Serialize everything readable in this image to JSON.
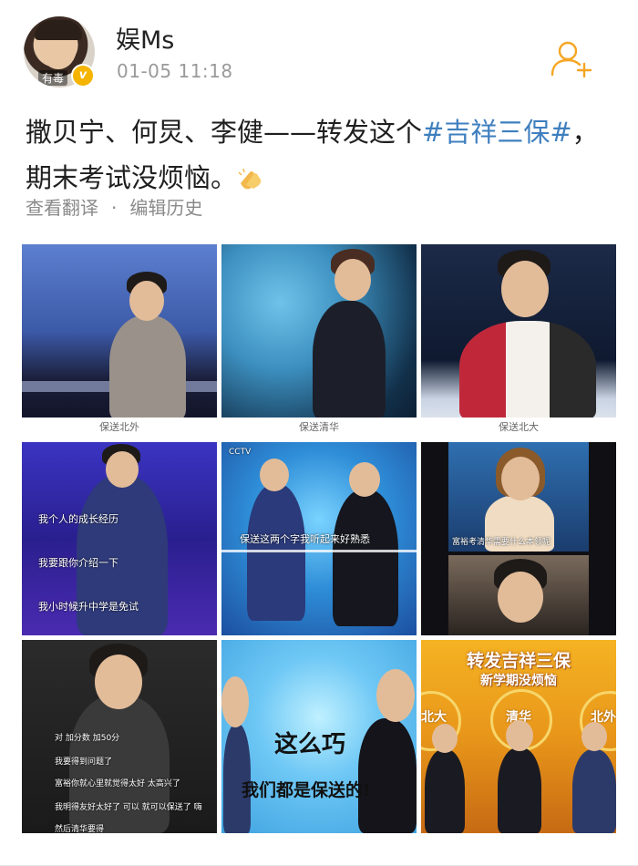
{
  "post": {
    "username": "娱Ms",
    "timestamp": "01-05 11:18",
    "avatar_tag": "有毒",
    "verified_badge": "v",
    "text_before": "撒贝宁、何炅、李健——转发这个",
    "hashtag": "#吉祥三保#",
    "text_after": "，期末考试没烦恼。",
    "see_translation": "查看翻译",
    "separator": "·",
    "edit_history": "编辑历史"
  },
  "photos": {
    "p1": {
      "caption": "保送北外"
    },
    "p2": {
      "caption": "保送清华"
    },
    "p3": {
      "caption": "保送北大"
    },
    "p4": {
      "sub1": "我个人的成长经历",
      "sub2": "我要跟你介绍一下",
      "sub3": "我小时候升中学是免试"
    },
    "p5": {
      "sub1": "保送这两个字我听起来好熟悉",
      "logo": "CCTV"
    },
    "p6": {
      "sub1": "富裕考清华需要什么本领呢"
    },
    "p7": {
      "sub1": "对 加分数 加50分",
      "sub2": "我要得到问题了",
      "sub3": "富裕你就心里就觉得太好 太高兴了",
      "sub4": "我明得友好太好了 可以 就可以保送了 嗨",
      "sub5": "然后清华要得"
    },
    "p8": {
      "line1": "这么巧",
      "line2": "我们都是保送的!"
    },
    "p9": {
      "title1": "转发吉祥三保",
      "title2": "新学期没烦恼",
      "label_left": "北大",
      "label_mid": "清华",
      "label_right": "北外"
    }
  },
  "icons": {
    "follow": "add-user-icon",
    "clap": "clapping-hands-icon"
  },
  "colors": {
    "hashtag": "#3f7fbf",
    "follow": "#f5a623",
    "badge": "#f4b400"
  }
}
